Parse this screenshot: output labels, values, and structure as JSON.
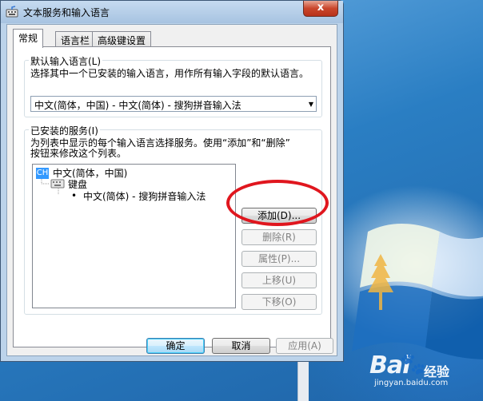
{
  "window": {
    "title": "文本服务和输入语言",
    "close_label": "x"
  },
  "tabs": [
    {
      "label": "常规",
      "active": true
    },
    {
      "label": "语言栏",
      "active": false
    },
    {
      "label": "高级键设置",
      "active": false
    }
  ],
  "default_language": {
    "group_label": "默认输入语言(L)",
    "description": "选择其中一个已安装的输入语言，用作所有输入字段的默认语言。",
    "selected": "中文(简体，中国) - 中文(简体) - 搜狗拼音输入法"
  },
  "installed_services": {
    "group_label": "已安装的服务(I)",
    "description_line1": "为列表中显示的每个输入语言选择服务。使用“添加”和“删除”",
    "description_line2": "按钮来修改这个列表。",
    "tree": {
      "badge": "CH",
      "language": "中文(简体，中国)",
      "category": "键盘",
      "service": "中文(简体) - 搜狗拼音输入法"
    },
    "buttons": {
      "add": "添加(D)...",
      "remove": "删除(R)",
      "properties": "属性(P)...",
      "move_up": "上移(U)",
      "move_down": "下移(O)"
    }
  },
  "footer": {
    "ok": "确定",
    "cancel": "取消",
    "apply": "应用(A)"
  },
  "watermark": {
    "brand": "Bai",
    "brand2": "经验",
    "url": "jingyan.baidu.com"
  },
  "colors": {
    "highlight": "#3399ff",
    "annotation_oval": "#e0161e"
  }
}
